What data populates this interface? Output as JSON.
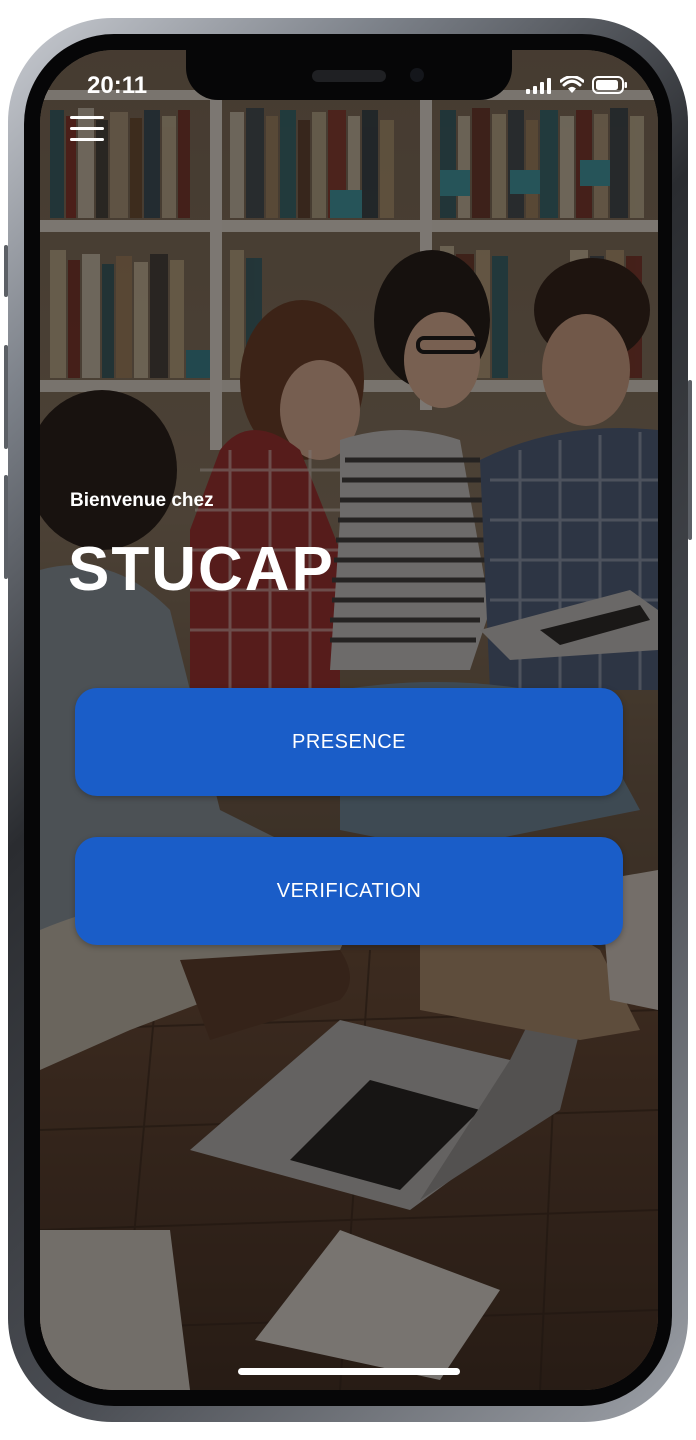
{
  "status_bar": {
    "time": "20:11",
    "icons": [
      "cellular-signal-icon",
      "wifi-icon",
      "battery-icon"
    ]
  },
  "header": {
    "menu_icon": "hamburger-menu-icon"
  },
  "hero": {
    "welcome_text": "Bienvenue chez",
    "brand_name": "STUCAP"
  },
  "actions": {
    "presence_label": "PRESENCE",
    "verification_label": "VERIFICATION"
  },
  "colors": {
    "primary_button": "#1a5dc8",
    "text": "#ffffff",
    "overlay": "rgba(20,16,14,0.52)"
  }
}
